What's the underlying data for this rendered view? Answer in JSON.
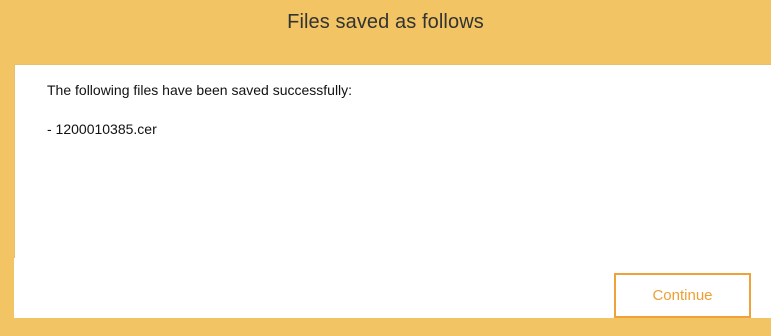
{
  "dialog": {
    "title": "Files saved as follows",
    "message": "The following files have been saved successfully:",
    "files": [
      "- 1200010385.cer"
    ],
    "continue_label": "Continue"
  },
  "colors": {
    "frame": "#f2c463",
    "accent": "#f0a23a",
    "content_background": "#ffffff",
    "title_text": "#333333",
    "body_text": "#111111"
  }
}
